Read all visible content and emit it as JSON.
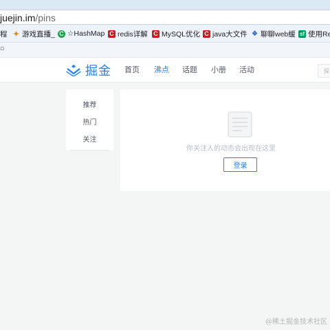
{
  "browser": {
    "url_host": "juejin.im",
    "url_path": "/pins",
    "bookmarks": [
      {
        "label": "程",
        "icon": "none"
      },
      {
        "label": "游戏直播_",
        "icon": "game-icon"
      },
      {
        "label": "☆HashMap",
        "icon": "c-circle-icon"
      },
      {
        "label": "redis详解",
        "icon": "c-red-icon"
      },
      {
        "label": "MySQL优化",
        "icon": "c-red-icon"
      },
      {
        "label": "java大文件",
        "icon": "c-red-icon"
      },
      {
        "label": "聊聊web缓",
        "icon": "chat-icon"
      },
      {
        "label": "使用Red",
        "icon": "sf-icon"
      }
    ]
  },
  "header": {
    "logo_text": "掘金",
    "nav": [
      {
        "label": "首页",
        "active": false
      },
      {
        "label": "沸点",
        "active": true
      },
      {
        "label": "话题",
        "active": false
      },
      {
        "label": "小册",
        "active": false
      },
      {
        "label": "活动",
        "active": false
      }
    ],
    "search_placeholder": "探"
  },
  "side_menu": {
    "items": [
      "推荐",
      "热门",
      "关注"
    ]
  },
  "main": {
    "empty_text": "你关注人的动态会出现在这里",
    "login_label": "登录"
  },
  "watermark": "@稀土掘金技术社区",
  "colors": {
    "accent": "#1e80ff",
    "page_bg": "#f4f5f5",
    "muted_text": "#b7bcc5"
  }
}
